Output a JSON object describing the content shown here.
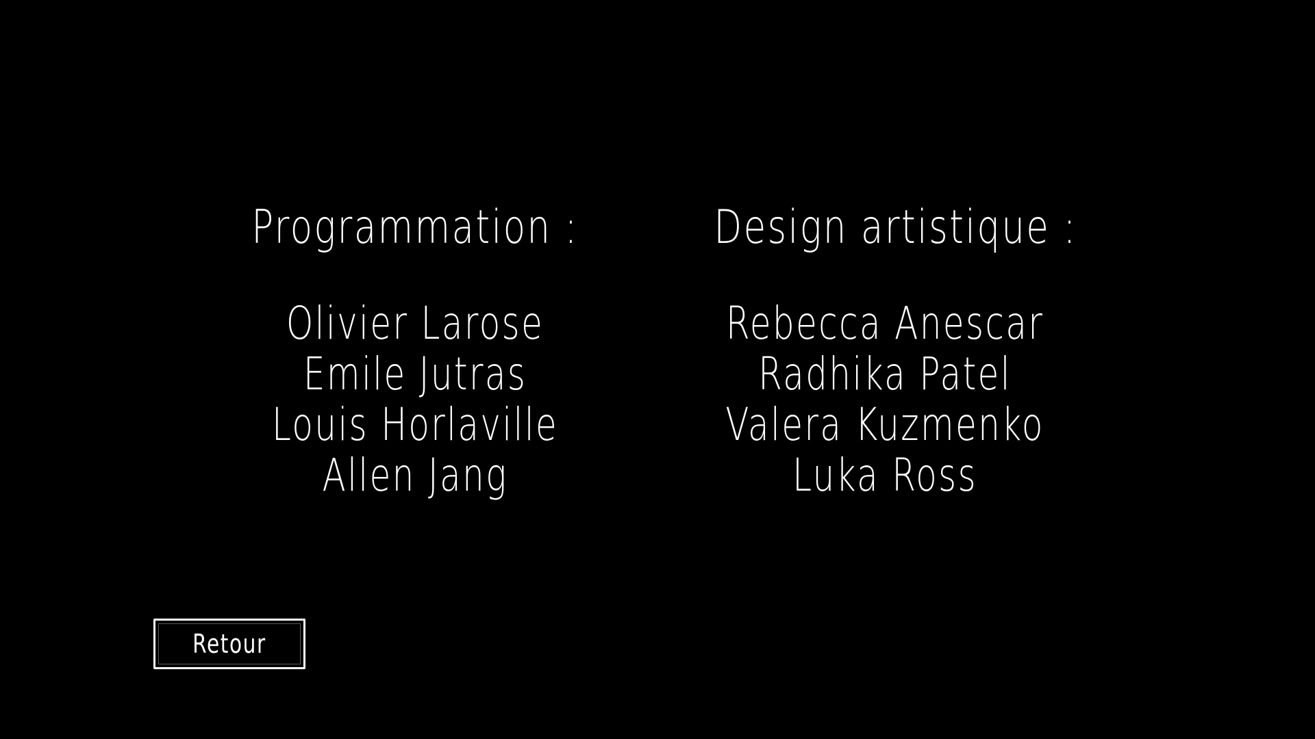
{
  "credits": {
    "programming": {
      "heading": "Programmation :",
      "names": [
        "Olivier Larose",
        "Emile Jutras",
        "Louis Horlaville",
        "Allen Jang"
      ]
    },
    "art": {
      "heading": "Design artistique :",
      "names": [
        "Rebecca Anescar",
        "Radhika Patel",
        "Valera Kuzmenko",
        "Luka Ross"
      ]
    }
  },
  "back_button": {
    "label": "Retour"
  },
  "colors": {
    "background": "#000000",
    "text": "#ffffff"
  }
}
